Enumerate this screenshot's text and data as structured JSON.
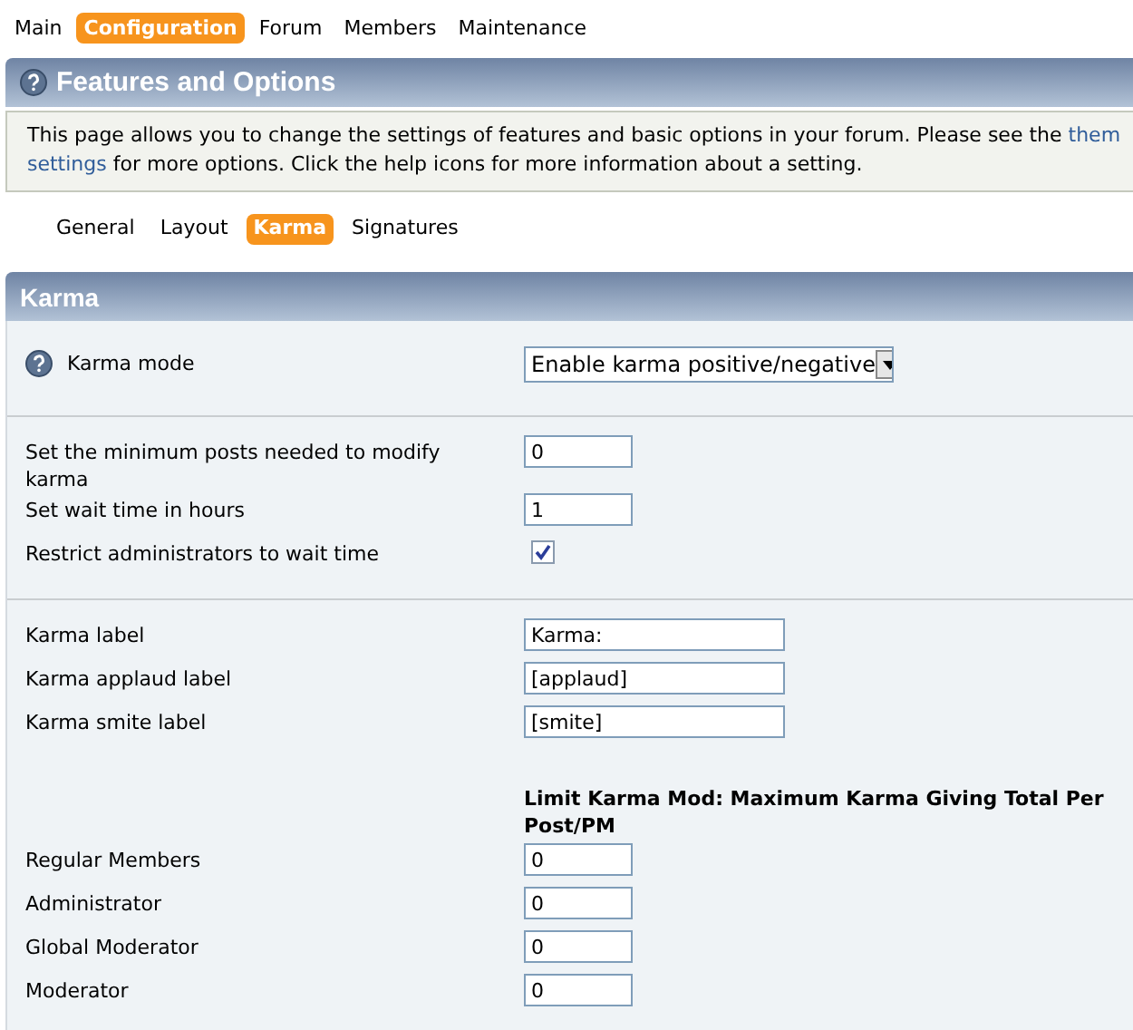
{
  "nav": [
    {
      "label": "Main",
      "selected": false
    },
    {
      "label": "Configuration",
      "selected": true
    },
    {
      "label": "Forum",
      "selected": false
    },
    {
      "label": "Members",
      "selected": false
    },
    {
      "label": "Maintenance",
      "selected": false
    }
  ],
  "page_title": "Features and Options",
  "description": {
    "text_before": "This page allows you to change the settings of features and basic options in your forum. Please see the",
    "link_part1": "them",
    "link_part2": "settings",
    "text_after": "for more options. Click the help icons for more information about a setting."
  },
  "tabs": [
    {
      "label": "General",
      "selected": false
    },
    {
      "label": "Layout",
      "selected": false
    },
    {
      "label": "Karma",
      "selected": true
    },
    {
      "label": "Signatures",
      "selected": false
    }
  ],
  "section_title": "Karma",
  "groups": [
    {
      "rows": [
        {
          "kind": "select",
          "help": true,
          "label": "Karma mode",
          "value": "Enable karma positive/negative"
        }
      ]
    },
    {
      "rows": [
        {
          "kind": "number",
          "label": "Set the minimum posts needed to modify karma",
          "value": "0"
        },
        {
          "kind": "number",
          "label": "Set wait time in hours",
          "value": "1"
        },
        {
          "kind": "checkbox",
          "label": "Restrict administrators to wait time",
          "checked": true
        }
      ]
    },
    {
      "rows": [
        {
          "kind": "text",
          "label": "Karma label",
          "value": "Karma:"
        },
        {
          "kind": "text",
          "label": "Karma applaud label",
          "value": "[applaud]"
        },
        {
          "kind": "text",
          "label": "Karma smite label",
          "value": "[smite]"
        },
        {
          "kind": "heading",
          "text": "Limit Karma Mod: Maximum Karma Giving Total Per Post/PM"
        },
        {
          "kind": "number",
          "label": "Regular Members",
          "value": "0"
        },
        {
          "kind": "number",
          "label": "Administrator",
          "value": "0"
        },
        {
          "kind": "number",
          "label": "Global Moderator",
          "value": "0"
        },
        {
          "kind": "number",
          "label": "Moderator",
          "value": "0"
        }
      ]
    }
  ]
}
